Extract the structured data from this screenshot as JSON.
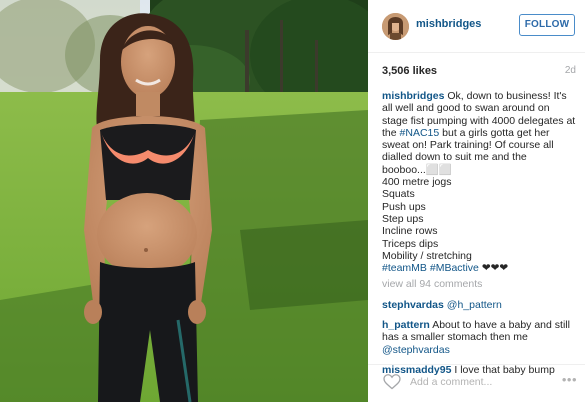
{
  "post": {
    "username": "mishbridges",
    "follow_label": "FOLLOW",
    "likes": "3,506 likes",
    "time_ago": "2d",
    "caption": {
      "user": "mishbridges",
      "text_before_tag": "Ok, down to business! It's all well and good to swan around on stage fist pumping with 4000 delegates at the",
      "hashtag1": "#NAC15",
      "text_after_tag": "but a girls gotta get her sweat on! Park training! Of course all dialled down to suit me and the booboo...",
      "emoji": "⬜⬜",
      "lines": [
        "400 metre jogs",
        "Squats",
        "Push ups",
        "Step ups",
        "Incline rows",
        "Triceps dips",
        "Mobility / stretching"
      ],
      "hashtag2": "#teamMB",
      "hashtag3": "#MBactive",
      "hearts": "❤❤❤"
    },
    "view_all_comments": "view all 94 comments",
    "comments": [
      {
        "user": "stephvardas",
        "mention": "@h_pattern",
        "text": ""
      },
      {
        "user": "h_pattern",
        "text": "About to have a baby and still has a smaller stomach then me",
        "mention": "@stephvardas"
      },
      {
        "user": "missmaddy95",
        "text": "I love that baby bump",
        "mention": ""
      }
    ],
    "add_comment_placeholder": "Add a comment...",
    "more_label": "•••"
  },
  "colors": {
    "link_blue": "#125688",
    "follow_blue": "#2d6aa9",
    "muted_gray": "#a5a7aa"
  },
  "icons": [
    "heart-icon",
    "more-options-icon",
    "avatar"
  ]
}
